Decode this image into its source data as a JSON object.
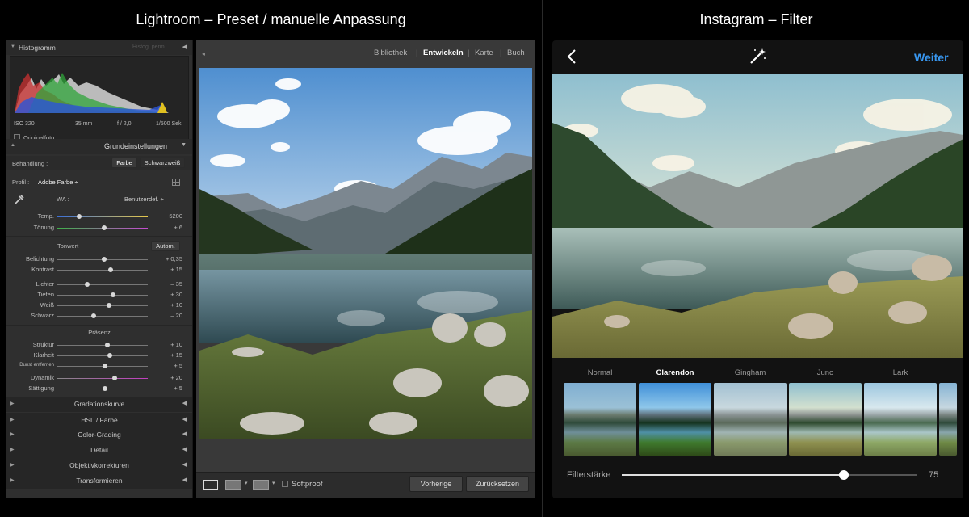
{
  "titles": {
    "left": "Lightroom – Preset / manuelle Anpassung",
    "right": "Instagram – Filter"
  },
  "lightroom": {
    "histogram": {
      "title": "Histogramm",
      "right_label": "Histog. perm",
      "iso": "ISO 320",
      "focal": "35 mm",
      "aperture": "f / 2,0",
      "shutter": "1/500 Sek.",
      "original_photo": "Originalfoto"
    },
    "basic": {
      "title": "Grundeinstellungen",
      "treatment_label": "Behandlung :",
      "treatment_color": "Farbe",
      "treatment_bw": "Schwarzweiß",
      "profile_label": "Profil :",
      "profile_value": "Adobe Farbe ÷",
      "wb_label": "WA :",
      "wb_value": "Benutzerdef. ÷",
      "tone_label": "Tonwert",
      "auto": "Autom.",
      "presence_label": "Präsenz",
      "temp": {
        "name": "Temp.",
        "value": "5200",
        "pos": 0.24
      },
      "tint": {
        "name": "Tönung",
        "value": "+ 6",
        "pos": 0.52
      },
      "exposure": {
        "name": "Belichtung",
        "value": "+ 0,35",
        "pos": 0.52
      },
      "contrast": {
        "name": "Kontrast",
        "value": "+ 15",
        "pos": 0.59
      },
      "highlights": {
        "name": "Lichter",
        "value": "– 35",
        "pos": 0.33
      },
      "shadows": {
        "name": "Tiefen",
        "value": "+ 30",
        "pos": 0.62
      },
      "whites": {
        "name": "Weiß",
        "value": "+ 10",
        "pos": 0.57
      },
      "blacks": {
        "name": "Schwarz",
        "value": "– 20",
        "pos": 0.4
      },
      "texture": {
        "name": "Struktur",
        "value": "+ 10",
        "pos": 0.55
      },
      "clarity": {
        "name": "Klarheit",
        "value": "+ 15",
        "pos": 0.58
      },
      "dehaze": {
        "name": "Dunst entfernen",
        "value": "+ 5",
        "pos": 0.53
      },
      "vibrance": {
        "name": "Dynamik",
        "value": "+ 20",
        "pos": 0.63
      },
      "saturation": {
        "name": "Sättigung",
        "value": "+ 5",
        "pos": 0.53
      }
    },
    "panels": {
      "tone_curve": "Gradationskurve",
      "hsl": "HSL / Farbe",
      "color_grading": "Color-Grading",
      "detail": "Detail",
      "lens": "Objektivkorrekturen",
      "transform": "Transformieren"
    },
    "tabs": {
      "library": "Bibliothek",
      "develop": "Entwickeln",
      "map": "Karte",
      "book": "Buch"
    },
    "toolbar": {
      "softproof": "Softproof",
      "previous": "Vorherige",
      "reset": "Zurücksetzen"
    }
  },
  "instagram": {
    "next": "Weiter",
    "filters": [
      "Normal",
      "Clarendon",
      "Gingham",
      "Juno",
      "Lark"
    ],
    "selected_filter": "Clarendon",
    "strength_label": "Filterstärke",
    "strength_value": "75",
    "strength_fraction": 0.75
  },
  "colors": {
    "instagram_accent": "#3897f0",
    "lightroom_panel": "#2f2f2f"
  }
}
